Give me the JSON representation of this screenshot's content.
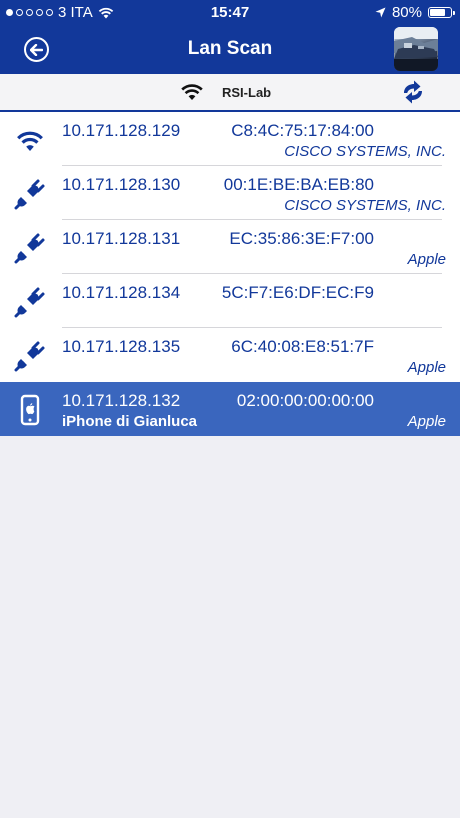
{
  "status_bar": {
    "carrier": "3 ITA",
    "time": "15:47",
    "battery": "80%",
    "battery_level": 0.8
  },
  "header": {
    "title": "Lan Scan"
  },
  "network": {
    "ssid": "RSI-Lab"
  },
  "devices": [
    {
      "icon": "wifi-icon",
      "ip": "10.171.128.129",
      "mac": "C8:4C:75:17:84:00",
      "vendor": "CISCO SYSTEMS, INC.",
      "name": ""
    },
    {
      "icon": "plug-icon",
      "ip": "10.171.128.130",
      "mac": "00:1E:BE:BA:EB:80",
      "vendor": "CISCO SYSTEMS, INC.",
      "name": ""
    },
    {
      "icon": "plug-icon",
      "ip": "10.171.128.131",
      "mac": "EC:35:86:3E:F7:00",
      "vendor": "Apple",
      "name": ""
    },
    {
      "icon": "plug-icon",
      "ip": "10.171.128.134",
      "mac": "5C:F7:E6:DF:EC:F9",
      "vendor": "",
      "name": ""
    },
    {
      "icon": "plug-icon",
      "ip": "10.171.128.135",
      "mac": "6C:40:08:E8:51:7F",
      "vendor": "Apple",
      "name": ""
    },
    {
      "icon": "iphone-icon",
      "ip": "10.171.128.132",
      "mac": "02:00:00:00:00:00",
      "vendor": "Apple",
      "name": "iPhone di Gianluca",
      "selected": true
    }
  ],
  "colors": {
    "accent": "#12389a",
    "selected_row": "#3a66be",
    "background": "#efeff4"
  }
}
